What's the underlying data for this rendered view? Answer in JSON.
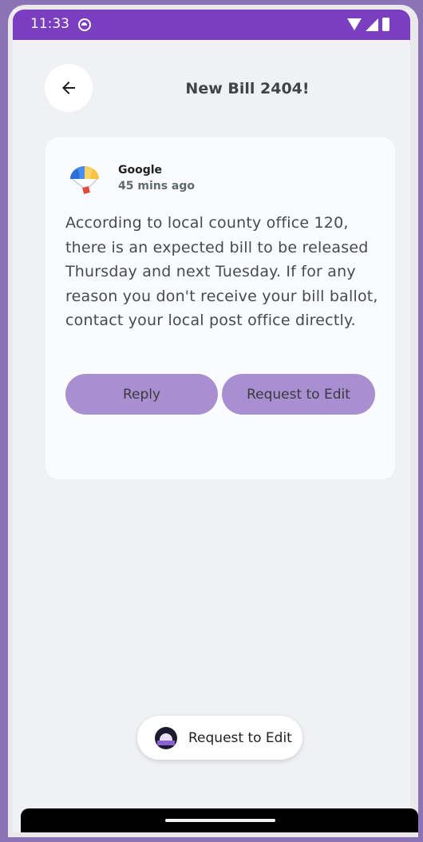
{
  "status": {
    "time": "11:33"
  },
  "header": {
    "title": "New Bill 2404!"
  },
  "message": {
    "sender": "Google",
    "time_ago": "45 mins ago",
    "body": "According to local county office 120, there is an expected bill to be released Thursday and next Tuesday. If for any reason you don't receive your bill ballot, contact your local post office directly.",
    "reply_label": "Reply",
    "edit_label": "Request to Edit"
  },
  "chip": {
    "label": "Request to Edit"
  },
  "colors": {
    "status_bar": "#7b3ec1",
    "button": "#a98fd2",
    "card": "#fafbfd",
    "background": "#f0f1f4"
  }
}
